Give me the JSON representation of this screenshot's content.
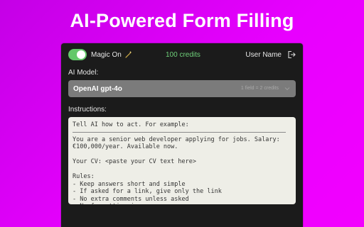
{
  "hero": {
    "title": "AI-Powered Form Filling"
  },
  "header": {
    "magic_toggle_label": "Magic On",
    "magic_toggle_checked": true,
    "magic_icon": "wand-icon",
    "credits": "100 credits",
    "user_name": "User Name",
    "logout_icon": "logout-icon"
  },
  "model": {
    "label": "AI Model:",
    "selected": "OpenAI gpt-4o",
    "cost": "1 field = 2 credits",
    "chevron_icon": "chevron-down-icon"
  },
  "instructions": {
    "label": "Instructions:",
    "intro": "Tell AI how to act. For example:",
    "body": "You are a senior web developer applying for jobs. Salary:\n€100,000/year. Available now.\n\nYour CV: <paste your CV text here>\n\nRules:\n- Keep answers short and simple\n- If asked for a link, give only the link\n- No extra comments unless asked\n- No formatting in answer"
  },
  "colors": {
    "background_start": "#c400e6",
    "background_end": "#f200ff",
    "panel": "#1b1b1b",
    "toggle_on": "#63c86a",
    "credits_text": "#6fd17a",
    "select_bg": "#7b7b7b",
    "textarea_bg": "#eeeee7"
  }
}
